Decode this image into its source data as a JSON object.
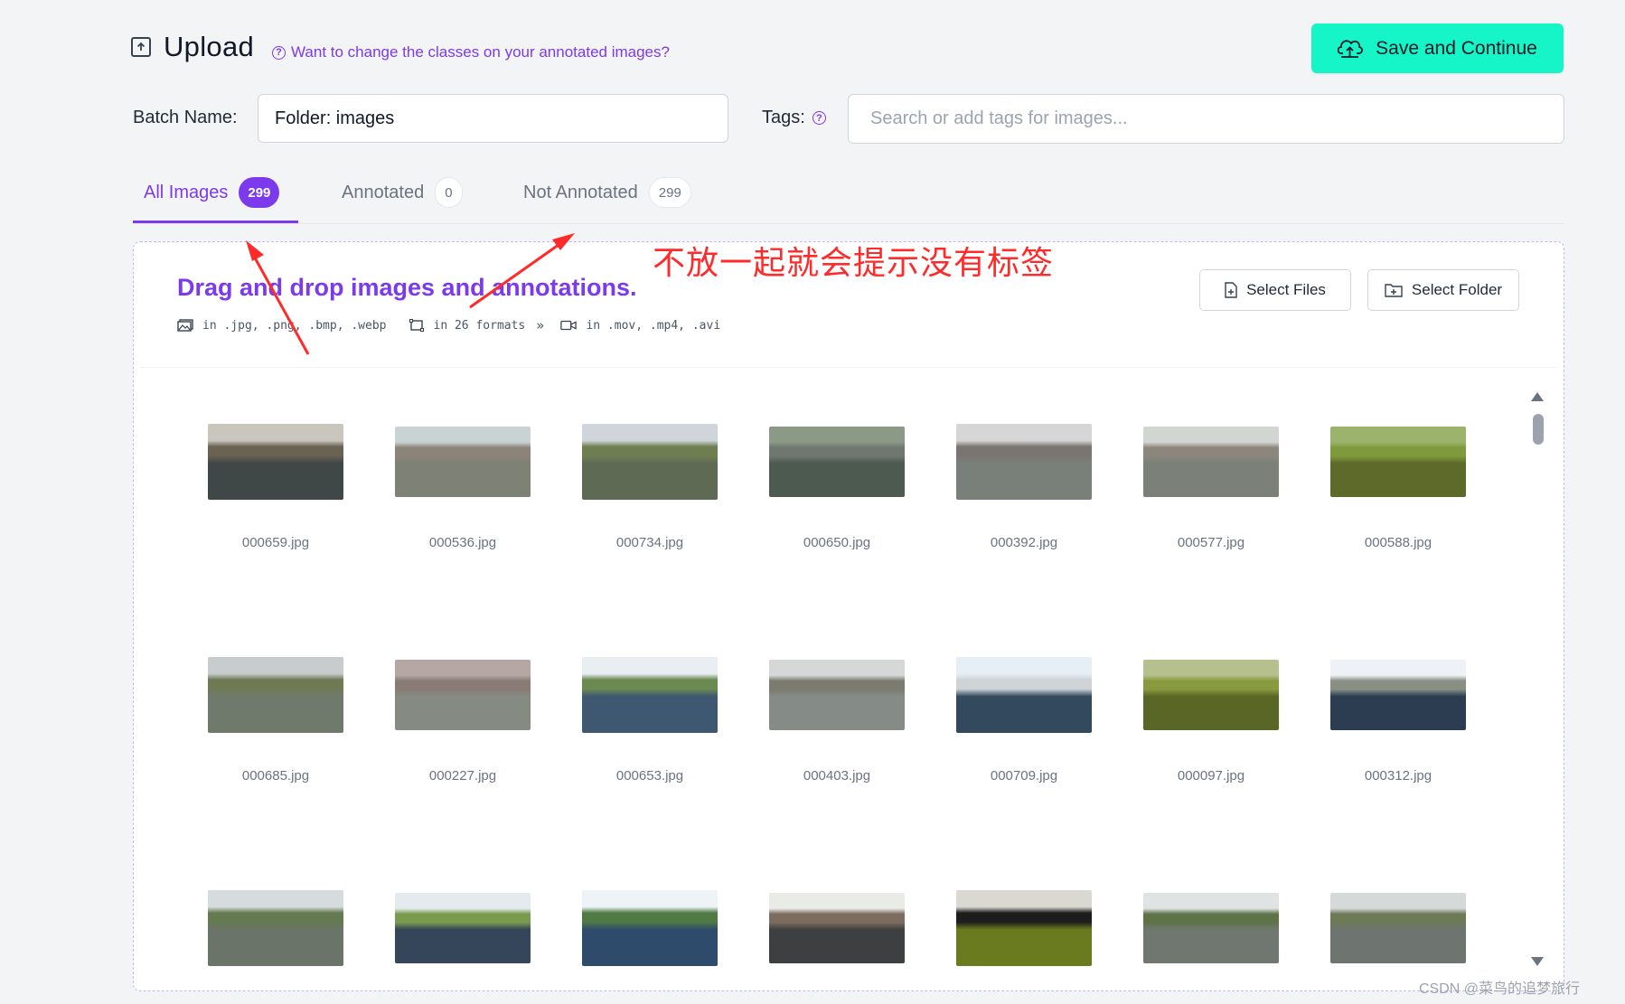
{
  "header": {
    "title": "Upload",
    "help_link": "Want to change the classes on your annotated images?",
    "save_button": "Save and Continue"
  },
  "batch": {
    "label": "Batch Name:",
    "value": "Folder: images"
  },
  "tags": {
    "label": "Tags:",
    "placeholder": "Search or add tags for images..."
  },
  "tabs": [
    {
      "label": "All Images",
      "count": "299",
      "active": true
    },
    {
      "label": "Annotated",
      "count": "0",
      "active": false
    },
    {
      "label": "Not Annotated",
      "count": "299",
      "active": false
    }
  ],
  "dropzone": {
    "title": "Drag and drop images and annotations.",
    "image_formats": "in .jpg, .png, .bmp, .webp",
    "annotation_formats": "in 26 formats",
    "video_formats": "in .mov, .mp4, .avi",
    "select_files": "Select Files",
    "select_folder": "Select Folder"
  },
  "images": [
    {
      "name": "000659.jpg",
      "sky": "#c9c6bd",
      "water": "#3f4747",
      "bank": "#6a6253"
    },
    {
      "name": "000536.jpg",
      "sky": "#c9d3d4",
      "water": "#7d8176",
      "bank": "#8d8479"
    },
    {
      "name": "000734.jpg",
      "sky": "#cfd5db",
      "water": "#5f6a55",
      "bank": "#6f7e50"
    },
    {
      "name": "000650.jpg",
      "sky": "#8b9a86",
      "water": "#4d5a50",
      "bank": "#707670"
    },
    {
      "name": "000392.jpg",
      "sky": "#d6d6d6",
      "water": "#79807a",
      "bank": "#7a7570"
    },
    {
      "name": "000577.jpg",
      "sky": "#d3d5d3",
      "water": "#7b8179",
      "bank": "#8b877c"
    },
    {
      "name": "000588.jpg",
      "sky": "#9cb36e",
      "water": "#5d6a2a",
      "bank": "#7e9a3c"
    },
    {
      "name": "000685.jpg",
      "sky": "#c8cccc",
      "water": "#707a6c",
      "bank": "#6f7a55"
    },
    {
      "name": "000227.jpg",
      "sky": "#b5a8a4",
      "water": "#858a83",
      "bank": "#8a7b74"
    },
    {
      "name": "000653.jpg",
      "sky": "#e9eef2",
      "water": "#3f5871",
      "bank": "#6b8a52"
    },
    {
      "name": "000403.jpg",
      "sky": "#d5d8d7",
      "water": "#858c87",
      "bank": "#7b7b6f"
    },
    {
      "name": "000709.jpg",
      "sky": "#e6eef6",
      "water": "#33495d",
      "bank": "#cfd3d6"
    },
    {
      "name": "000097.jpg",
      "sky": "#b6c08d",
      "water": "#5a6626",
      "bank": "#879a3d"
    },
    {
      "name": "000312.jpg",
      "sky": "#eef2f6",
      "water": "#2c3d52",
      "bank": "#8a8f86"
    },
    {
      "name": "",
      "sky": "#d6dbde",
      "water": "#6b7468",
      "bank": "#647a51"
    },
    {
      "name": "",
      "sky": "#e4eaee",
      "water": "#35465a",
      "bank": "#7a9a4e"
    },
    {
      "name": "",
      "sky": "#eef3f7",
      "water": "#2e4b6b",
      "bank": "#4f7a44"
    },
    {
      "name": "",
      "sky": "#e9ebe6",
      "water": "#3d3f40",
      "bank": "#7c6c60"
    },
    {
      "name": "",
      "sky": "#d9d9d2",
      "water": "#6a7a1f",
      "bank": "#1d1d1d"
    },
    {
      "name": "",
      "sky": "#dfe3e4",
      "water": "#6f7770",
      "bank": "#5e7448"
    },
    {
      "name": "",
      "sky": "#d5d9da",
      "water": "#6e7570",
      "bank": "#6c7a55"
    }
  ],
  "annotation": {
    "text": "不放一起就会提示没有标签"
  },
  "watermark": "CSDN @菜鸟的追梦旅行",
  "colors": {
    "accent": "#7c3aed",
    "save": "#15f5c8",
    "annotation_red": "#ff2a2a"
  }
}
